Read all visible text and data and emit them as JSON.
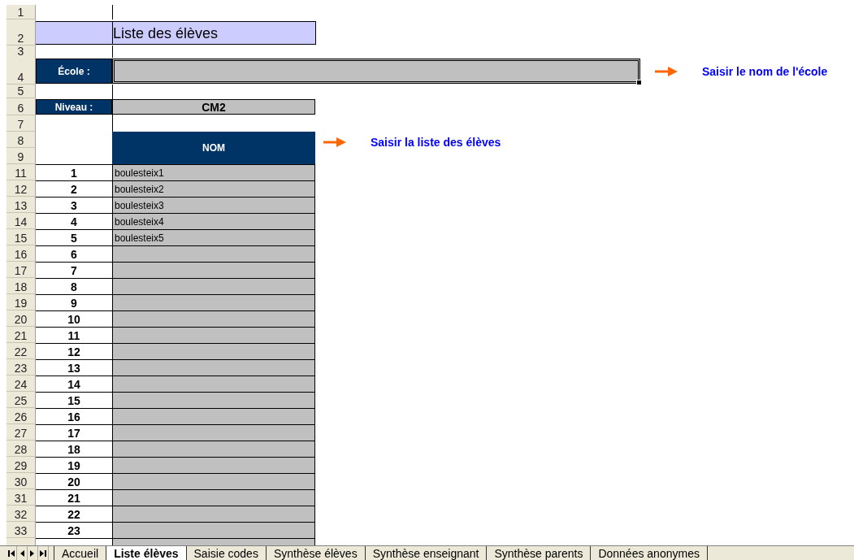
{
  "rows": [
    {
      "kind": "blank",
      "header": "1"
    },
    {
      "kind": "title",
      "header": "2",
      "title": "Liste des élèves"
    },
    {
      "kind": "blank",
      "header": "3"
    },
    {
      "kind": "school",
      "header": "4",
      "label": "École :",
      "selected": true,
      "note": "Saisir le nom de l'école"
    },
    {
      "kind": "blank",
      "header": "5"
    },
    {
      "kind": "level",
      "header": "6",
      "label": "Niveau :",
      "value": "CM2"
    },
    {
      "kind": "blank",
      "header": "7"
    },
    {
      "kind": "column_header",
      "headers": [
        "8",
        "9"
      ],
      "label": "NOM",
      "note": "Saisir la liste des élèves"
    }
  ],
  "students": [
    {
      "header": "11",
      "number": "1",
      "name": "boulesteix1"
    },
    {
      "header": "12",
      "number": "2",
      "name": "boulesteix2"
    },
    {
      "header": "13",
      "number": "3",
      "name": "boulesteix3"
    },
    {
      "header": "14",
      "number": "4",
      "name": "boulesteix4"
    },
    {
      "header": "15",
      "number": "5",
      "name": "boulesteix5"
    },
    {
      "header": "16",
      "number": "6"
    },
    {
      "header": "17",
      "number": "7"
    },
    {
      "header": "18",
      "number": "8"
    },
    {
      "header": "19",
      "number": "9"
    },
    {
      "header": "20",
      "number": "10"
    },
    {
      "header": "21",
      "number": "11"
    },
    {
      "header": "22",
      "number": "12"
    },
    {
      "header": "23",
      "number": "13"
    },
    {
      "header": "24",
      "number": "14"
    },
    {
      "header": "25",
      "number": "15"
    },
    {
      "header": "26",
      "number": "16"
    },
    {
      "header": "27",
      "number": "17"
    },
    {
      "header": "28",
      "number": "18"
    },
    {
      "header": "29",
      "number": "19"
    },
    {
      "header": "30",
      "number": "20"
    },
    {
      "header": "31",
      "number": "21"
    },
    {
      "header": "32",
      "number": "22"
    },
    {
      "header": "33",
      "number": "23"
    }
  ],
  "sheet_tabs": [
    {
      "label": "Accueil",
      "selected": false
    },
    {
      "label": "Liste élèves",
      "selected": true
    },
    {
      "label": "Saisie codes",
      "selected": false
    },
    {
      "label": "Synthèse élèves",
      "selected": false
    },
    {
      "label": "Synthèse enseignant",
      "selected": false
    },
    {
      "label": "Synthèse parents",
      "selected": false
    },
    {
      "label": "Données anonymes",
      "selected": false
    }
  ]
}
